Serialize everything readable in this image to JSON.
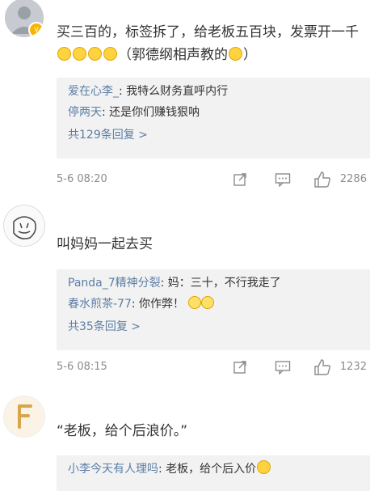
{
  "comments": [
    {
      "text_a": "买三百的，标签拆了，给老板五百块，发票开一千",
      "text_b": "（郭德纲相声教的",
      "text_c": "）",
      "emoji": "smirk-face",
      "replies": [
        {
          "user": "爱在心李_",
          "text": ": 我特么财务直呼内行"
        },
        {
          "user": "停两天",
          "text": ": 还是你们赚钱狠呐"
        }
      ],
      "more": "共129条回复 >",
      "time": "5-6 08:20",
      "likes": "2286"
    },
    {
      "text": "叫妈妈一起去买",
      "replies": [
        {
          "user": "Panda_7精神分裂",
          "text": ": 妈：三十，不行我走了"
        },
        {
          "user": "春水煎茶-77",
          "text": ": 你作弊！"
        }
      ],
      "more": "共35条回复 >",
      "time": "5-6 08:15",
      "likes": "1232"
    },
    {
      "text": "“老板，给个后浪价。”",
      "replies": [
        {
          "user": "小李今天有人理吗",
          "text": ": 老板，给个后入价"
        }
      ]
    }
  ]
}
